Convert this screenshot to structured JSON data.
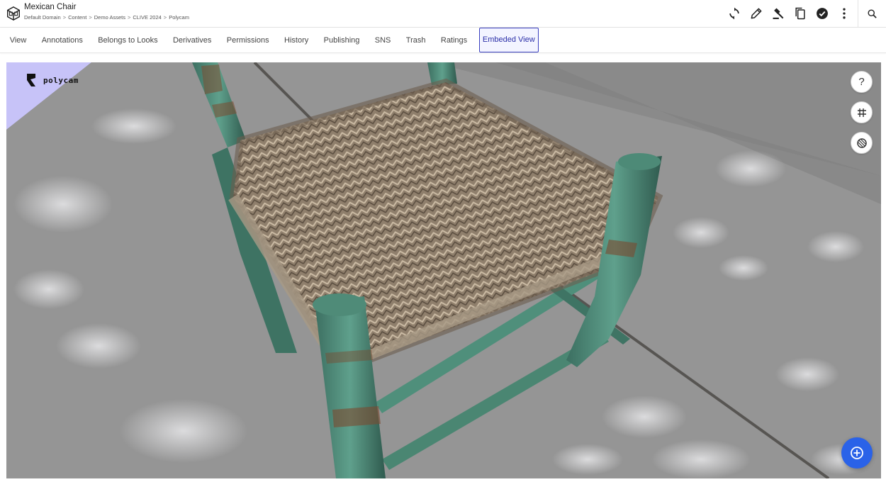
{
  "header": {
    "title": "Mexican Chair",
    "breadcrumb": [
      "Default Domain",
      "Content",
      "Demo Assets",
      "CLIVE 2024",
      "Polycam"
    ],
    "separator": ">",
    "icon": "cube-box-icon",
    "toolbar": [
      {
        "name": "refresh-icon"
      },
      {
        "name": "edit-pencil-icon"
      },
      {
        "name": "gavel-icon"
      },
      {
        "name": "copy-icon"
      },
      {
        "name": "check-circle-icon"
      },
      {
        "name": "more-vertical-icon"
      },
      {
        "name": "search-icon"
      }
    ]
  },
  "tabs": [
    {
      "label": "View"
    },
    {
      "label": "Annotations"
    },
    {
      "label": "Belongs to Looks"
    },
    {
      "label": "Derivatives"
    },
    {
      "label": "Permissions"
    },
    {
      "label": "History"
    },
    {
      "label": "Publishing"
    },
    {
      "label": "SNS"
    },
    {
      "label": "Trash"
    },
    {
      "label": "Ratings"
    },
    {
      "label": "Embeded View",
      "active": true
    }
  ],
  "viewer": {
    "brand": "polycam",
    "help_label": "?",
    "controls": [
      "help-icon",
      "grid-icon",
      "material-icon"
    ],
    "fab_icon": "add-circle-icon"
  },
  "colors": {
    "accent": "#3a3fbf",
    "fab": "#2a62e8",
    "sky": "#c7c3f8",
    "ground": "#8c8c8c",
    "chair_green": "#4c8a78",
    "seat": "#8f7f6c"
  }
}
